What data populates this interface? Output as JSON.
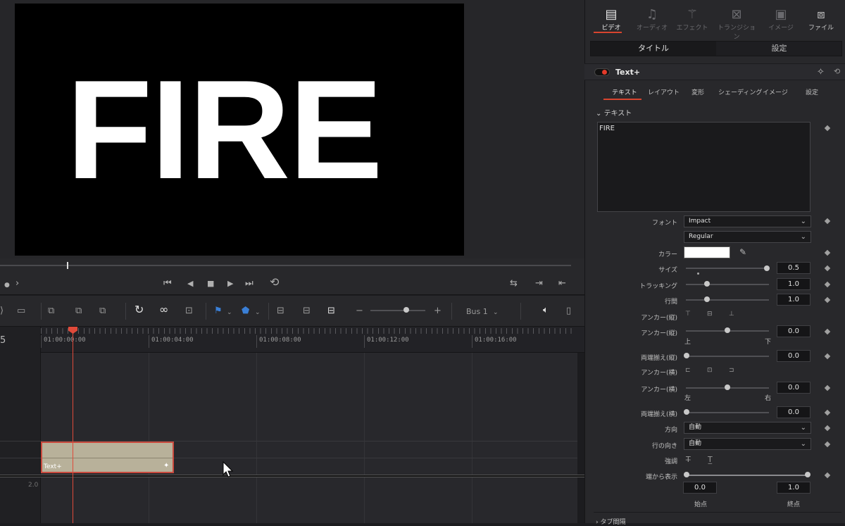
{
  "viewer": {
    "title_text": "FIRE"
  },
  "transport": {
    "prev_mark": "●",
    "next_arrow": "›",
    "skip_back": "⏮",
    "step_back": "◀",
    "stop": "■",
    "play": "▶",
    "skip_fwd": "⏭",
    "loop": "⟲",
    "match_frame": "⇆",
    "mark_in": "⇥",
    "mark_out": "⇤"
  },
  "timeline": {
    "track_label": "5",
    "audio_level": "2.0",
    "bus_label": "Bus 1",
    "timecodes": [
      "01:00:00:00",
      "01:00:04:00",
      "01:00:08:00",
      "01:00:12:00",
      "01:00:16:00"
    ],
    "clip_label": "Text+",
    "zoom_minus": "−",
    "zoom_plus": "+"
  },
  "inspector": {
    "tabs": [
      {
        "label": "ビデオ",
        "icon": "film-icon"
      },
      {
        "label": "オーディオ",
        "icon": "music-icon"
      },
      {
        "label": "エフェクト",
        "icon": "wand-icon"
      },
      {
        "label": "トランジション",
        "icon": "transition-icon"
      },
      {
        "label": "イメージ",
        "icon": "image-icon"
      },
      {
        "label": "ファイル",
        "icon": "file-icon"
      }
    ],
    "segments": [
      "タイトル",
      "設定"
    ],
    "effect_name": "Text+",
    "subtabs": [
      "テキスト",
      "レイアウト",
      "変形",
      "シェーディング",
      "イメージ",
      "設定"
    ],
    "section_title": "テキスト",
    "text_value": "FIRE",
    "font_label": "フォント",
    "font_value": "Impact",
    "style_value": "Regular",
    "color_label": "カラー",
    "color_value": "#ffffff",
    "size_label": "サイズ",
    "size_value": "0.5",
    "tracking_label": "トラッキング",
    "tracking_value": "1.0",
    "line_spacing_label": "行間",
    "line_spacing_value": "1.0",
    "anchor_v_label": "アンカー(縦)",
    "anchor_v2_label": "アンカー(縦)",
    "anchor_v2_value": "0.0",
    "top_label": "上",
    "bottom_label": "下",
    "justify_v_label": "両端揃え(縦)",
    "justify_v_value": "0.0",
    "anchor_h_label": "アンカー(横)",
    "anchor_h2_label": "アンカー(横)",
    "anchor_h2_value": "0.0",
    "left_label": "左",
    "right_label": "右",
    "justify_h_label": "両端揃え(横)",
    "justify_h_value": "0.0",
    "direction_label": "方向",
    "direction_value": "自動",
    "line_dir_label": "行の向き",
    "line_dir_value": "自動",
    "emphasis_label": "強調",
    "write_on_label": "端から表示",
    "start_value": "0.0",
    "end_value": "1.0",
    "start_label": "始点",
    "end_label": "終点",
    "next_section": "タブ間隔",
    "accent_color": "#d8452f"
  }
}
